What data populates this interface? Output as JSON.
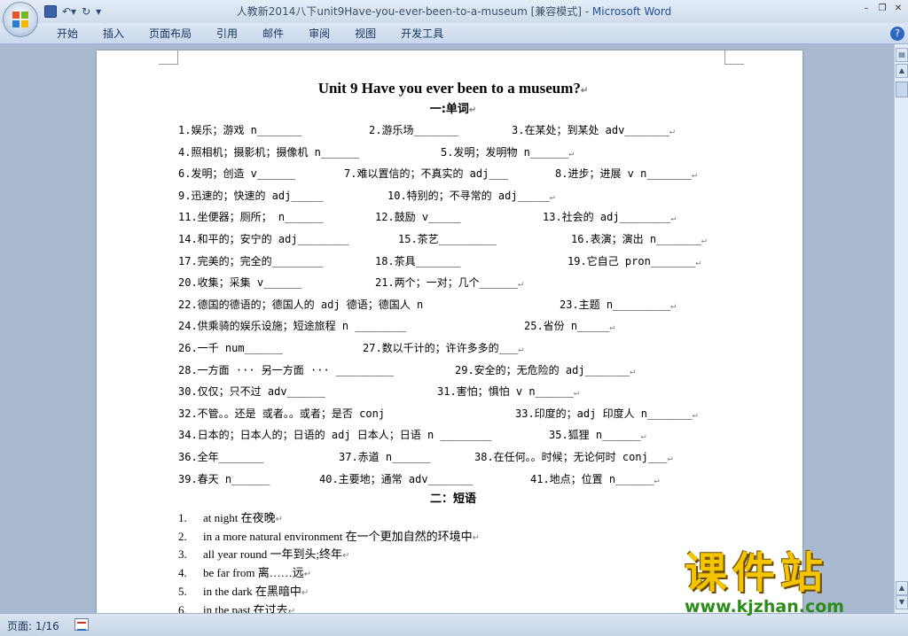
{
  "window": {
    "title": "人教新2014八下unit9Have-you-ever-been-to-a-museum [兼容模式] - ",
    "app_name": "Microsoft Word"
  },
  "ribbon": {
    "tabs": [
      "开始",
      "插入",
      "页面布局",
      "引用",
      "邮件",
      "审阅",
      "视图",
      "开发工具"
    ]
  },
  "document": {
    "title": "Unit 9    Have you ever been to a museum?",
    "section1": "一:单词",
    "vocab_rows": [
      [
        "1.娱乐；游戏 n_______",
        "2.游乐场_______",
        "3.在某处；到某处 adv_______"
      ],
      [
        "4.照相机；摄影机；摄像机 n______",
        "5.发明；发明物 n______"
      ],
      [
        "6.发明；创造 v______",
        "7.难以置信的；不真实的 adj___",
        "8.进步；进展 v n_______"
      ],
      [
        "9.迅速的；快速的 adj_____",
        "10.特别的；不寻常的 adj_____"
      ],
      [
        "11.坐便器；厕所； n______",
        "12.鼓励 v_____",
        "13.社会的 adj________"
      ],
      [
        "14.和平的；安宁的 adj________",
        "15.茶艺_________",
        "16.表演；演出 n_______"
      ],
      [
        "17.完美的；完全的________",
        "18.茶具_______",
        "19.它自己 pron_______"
      ],
      [
        "20.收集；采集 v______",
        "21.两个；一对；几个______"
      ],
      [
        "22.德国的德语的；德国人的 adj 德语；德国人 n",
        "23.主题 n_________"
      ],
      [
        "24.供乘骑的娱乐设施；短途旅程 n ________",
        "25.省份 n_____"
      ],
      [
        "26.一千 num______",
        "27.数以千计的；许许多多的___"
      ],
      [
        "28.一方面 ··· 另一方面 ··· _________",
        "29.安全的；无危险的 adj_______"
      ],
      [
        "30.仅仅；只不过 adv______",
        "31.害怕；惧怕 v  n______"
      ],
      [
        "32.不管。。还是 或者。。或者；是否 conj",
        "33.印度的；adj 印度人 n_______"
      ],
      [
        "34.日本的；日本人的；日语的 adj 日本人；日语 n ________",
        "35.狐狸 n______"
      ],
      [
        "36.全年_______",
        "37.赤道 n______",
        "38.在任何。。时候；无论何时 conj___"
      ],
      [
        "39.春天 n______",
        "40.主要地；通常 adv_______",
        "41.地点；位置 n______"
      ]
    ],
    "section2": "二：短语",
    "phrases": [
      {
        "num": "1.",
        "text": "at night 在夜晚"
      },
      {
        "num": "2.",
        "text": "in a more natural environment 在一个更加自然的环境中"
      },
      {
        "num": "3.",
        "text": "all year round 一年到头;终年"
      },
      {
        "num": "4.",
        "text": "be far from 离……远"
      },
      {
        "num": "5.",
        "text": "in the dark 在黑暗中"
      },
      {
        "num": "6.",
        "text": "in the past 在过去"
      }
    ],
    "paragraph_mark": "↵"
  },
  "statusbar": {
    "page": "页面: 1/16"
  },
  "watermark": {
    "brand": "课件站",
    "url": "www.kjzhan.com"
  }
}
